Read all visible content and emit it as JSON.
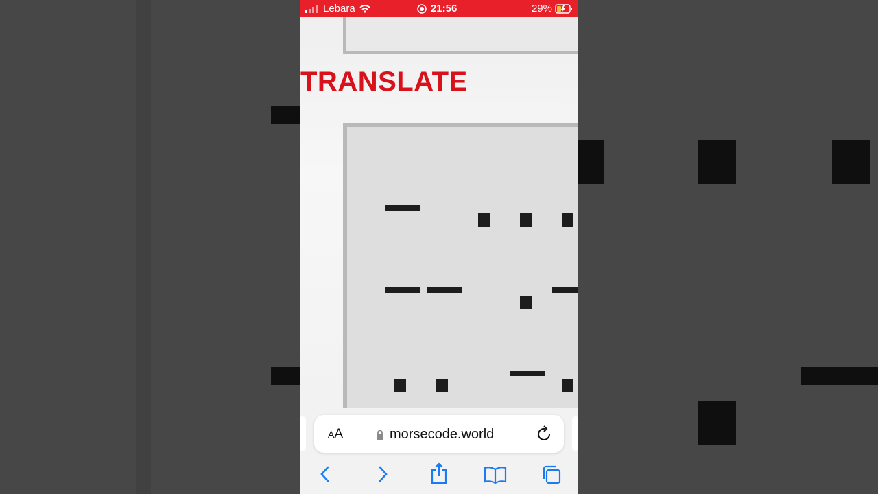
{
  "status_bar": {
    "carrier": "Lebara",
    "time": "21:56",
    "battery": "29%"
  },
  "page": {
    "heading": "TRANSLATE"
  },
  "address_bar": {
    "text_size_label": "AA",
    "url": "morsecode.world"
  },
  "colors": {
    "status_bar": "#e8202a",
    "heading": "#d8121b",
    "toolbar_icons": "#1a7cf0"
  },
  "icons": [
    "signal-icon",
    "wifi-icon",
    "recording-icon",
    "battery-charging-icon",
    "lock-icon",
    "reload-icon",
    "back-icon",
    "forward-icon",
    "share-icon",
    "bookmarks-icon",
    "tabs-icon"
  ]
}
